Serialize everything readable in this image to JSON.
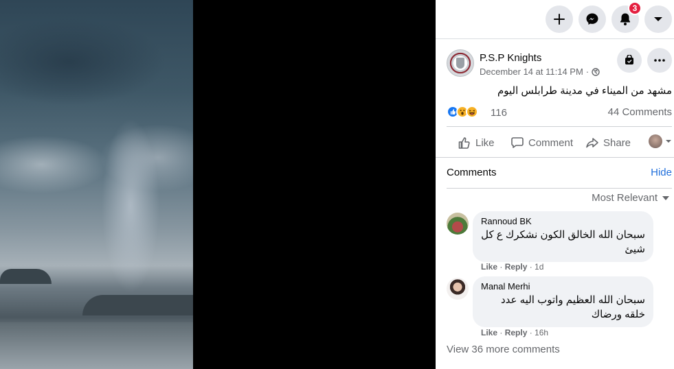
{
  "topbar": {
    "icons": [
      "plus-icon",
      "messenger-icon",
      "bell-icon",
      "caret-down-icon"
    ],
    "notification_count": "3"
  },
  "post": {
    "page_name": "P.S.P Knights",
    "date": "December 14 at 11:14 PM",
    "separator": "·",
    "caption": "مشهد من الميناء في مدينة طرابلس اليوم",
    "reaction_count": "116",
    "comments_count": "44 Comments"
  },
  "actions": {
    "like": "Like",
    "comment": "Comment",
    "share": "Share"
  },
  "comments_section": {
    "label": "Comments",
    "hide": "Hide",
    "sort": "Most Relevant",
    "view_more": "View 36 more comments",
    "items": [
      {
        "author": "Rannoud BK",
        "text": "سبحان الله الخالق الكون نشكرك ع كل شيئ",
        "like": "Like",
        "reply": "Reply",
        "time": "1d"
      },
      {
        "author": "Manal Merhi",
        "text": "سبحان الله العظيم واتوب اليه عدد خلقه ورضاك",
        "like": "Like",
        "reply": "Reply",
        "time": "16h"
      }
    ]
  }
}
